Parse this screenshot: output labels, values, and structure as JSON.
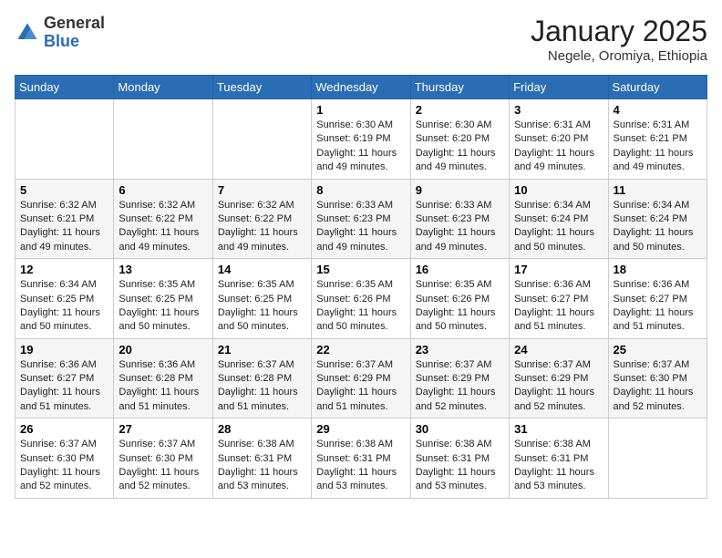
{
  "header": {
    "logo_general": "General",
    "logo_blue": "Blue",
    "month_title": "January 2025",
    "location": "Negele, Oromiya, Ethiopia"
  },
  "weekdays": [
    "Sunday",
    "Monday",
    "Tuesday",
    "Wednesday",
    "Thursday",
    "Friday",
    "Saturday"
  ],
  "weeks": [
    [
      {
        "day": "",
        "sunrise": "",
        "sunset": "",
        "daylight": ""
      },
      {
        "day": "",
        "sunrise": "",
        "sunset": "",
        "daylight": ""
      },
      {
        "day": "",
        "sunrise": "",
        "sunset": "",
        "daylight": ""
      },
      {
        "day": "1",
        "sunrise": "6:30 AM",
        "sunset": "6:19 PM",
        "daylight": "11 hours and 49 minutes."
      },
      {
        "day": "2",
        "sunrise": "6:30 AM",
        "sunset": "6:20 PM",
        "daylight": "11 hours and 49 minutes."
      },
      {
        "day": "3",
        "sunrise": "6:31 AM",
        "sunset": "6:20 PM",
        "daylight": "11 hours and 49 minutes."
      },
      {
        "day": "4",
        "sunrise": "6:31 AM",
        "sunset": "6:21 PM",
        "daylight": "11 hours and 49 minutes."
      }
    ],
    [
      {
        "day": "5",
        "sunrise": "6:32 AM",
        "sunset": "6:21 PM",
        "daylight": "11 hours and 49 minutes."
      },
      {
        "day": "6",
        "sunrise": "6:32 AM",
        "sunset": "6:22 PM",
        "daylight": "11 hours and 49 minutes."
      },
      {
        "day": "7",
        "sunrise": "6:32 AM",
        "sunset": "6:22 PM",
        "daylight": "11 hours and 49 minutes."
      },
      {
        "day": "8",
        "sunrise": "6:33 AM",
        "sunset": "6:23 PM",
        "daylight": "11 hours and 49 minutes."
      },
      {
        "day": "9",
        "sunrise": "6:33 AM",
        "sunset": "6:23 PM",
        "daylight": "11 hours and 49 minutes."
      },
      {
        "day": "10",
        "sunrise": "6:34 AM",
        "sunset": "6:24 PM",
        "daylight": "11 hours and 50 minutes."
      },
      {
        "day": "11",
        "sunrise": "6:34 AM",
        "sunset": "6:24 PM",
        "daylight": "11 hours and 50 minutes."
      }
    ],
    [
      {
        "day": "12",
        "sunrise": "6:34 AM",
        "sunset": "6:25 PM",
        "daylight": "11 hours and 50 minutes."
      },
      {
        "day": "13",
        "sunrise": "6:35 AM",
        "sunset": "6:25 PM",
        "daylight": "11 hours and 50 minutes."
      },
      {
        "day": "14",
        "sunrise": "6:35 AM",
        "sunset": "6:25 PM",
        "daylight": "11 hours and 50 minutes."
      },
      {
        "day": "15",
        "sunrise": "6:35 AM",
        "sunset": "6:26 PM",
        "daylight": "11 hours and 50 minutes."
      },
      {
        "day": "16",
        "sunrise": "6:35 AM",
        "sunset": "6:26 PM",
        "daylight": "11 hours and 50 minutes."
      },
      {
        "day": "17",
        "sunrise": "6:36 AM",
        "sunset": "6:27 PM",
        "daylight": "11 hours and 51 minutes."
      },
      {
        "day": "18",
        "sunrise": "6:36 AM",
        "sunset": "6:27 PM",
        "daylight": "11 hours and 51 minutes."
      }
    ],
    [
      {
        "day": "19",
        "sunrise": "6:36 AM",
        "sunset": "6:27 PM",
        "daylight": "11 hours and 51 minutes."
      },
      {
        "day": "20",
        "sunrise": "6:36 AM",
        "sunset": "6:28 PM",
        "daylight": "11 hours and 51 minutes."
      },
      {
        "day": "21",
        "sunrise": "6:37 AM",
        "sunset": "6:28 PM",
        "daylight": "11 hours and 51 minutes."
      },
      {
        "day": "22",
        "sunrise": "6:37 AM",
        "sunset": "6:29 PM",
        "daylight": "11 hours and 51 minutes."
      },
      {
        "day": "23",
        "sunrise": "6:37 AM",
        "sunset": "6:29 PM",
        "daylight": "11 hours and 52 minutes."
      },
      {
        "day": "24",
        "sunrise": "6:37 AM",
        "sunset": "6:29 PM",
        "daylight": "11 hours and 52 minutes."
      },
      {
        "day": "25",
        "sunrise": "6:37 AM",
        "sunset": "6:30 PM",
        "daylight": "11 hours and 52 minutes."
      }
    ],
    [
      {
        "day": "26",
        "sunrise": "6:37 AM",
        "sunset": "6:30 PM",
        "daylight": "11 hours and 52 minutes."
      },
      {
        "day": "27",
        "sunrise": "6:37 AM",
        "sunset": "6:30 PM",
        "daylight": "11 hours and 52 minutes."
      },
      {
        "day": "28",
        "sunrise": "6:38 AM",
        "sunset": "6:31 PM",
        "daylight": "11 hours and 53 minutes."
      },
      {
        "day": "29",
        "sunrise": "6:38 AM",
        "sunset": "6:31 PM",
        "daylight": "11 hours and 53 minutes."
      },
      {
        "day": "30",
        "sunrise": "6:38 AM",
        "sunset": "6:31 PM",
        "daylight": "11 hours and 53 minutes."
      },
      {
        "day": "31",
        "sunrise": "6:38 AM",
        "sunset": "6:31 PM",
        "daylight": "11 hours and 53 minutes."
      },
      {
        "day": "",
        "sunrise": "",
        "sunset": "",
        "daylight": ""
      }
    ]
  ],
  "labels": {
    "sunrise": "Sunrise:",
    "sunset": "Sunset:",
    "daylight": "Daylight:"
  }
}
